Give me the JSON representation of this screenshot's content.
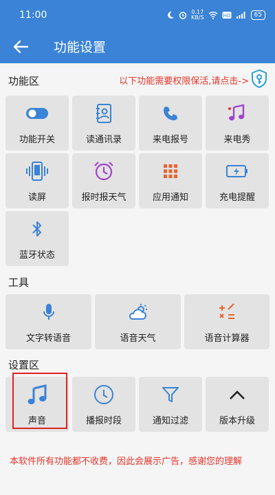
{
  "status_bar": {
    "time": "11:00",
    "net_speed": "0.17",
    "net_unit": "KB/S",
    "battery": "65"
  },
  "app_bar": {
    "title": "功能设置"
  },
  "sections": {
    "functions": "功能区",
    "notice": "以下功能需要权限保活,请点击->",
    "tools": "工具",
    "settings": "设置区"
  },
  "functions": [
    {
      "label": "功能开关",
      "icon": "toggle-icon"
    },
    {
      "label": "读通讯录",
      "icon": "contacts-icon"
    },
    {
      "label": "来电报号",
      "icon": "phone-icon"
    },
    {
      "label": "来电秀",
      "icon": "music-icon"
    },
    {
      "label": "读屏",
      "icon": "vibrate-phone-icon"
    },
    {
      "label": "报时报天气",
      "icon": "alarm-clock-icon"
    },
    {
      "label": "应用通知",
      "icon": "grid-icon"
    },
    {
      "label": "充电提醒",
      "icon": "battery-charging-icon"
    },
    {
      "label": "蓝牙状态",
      "icon": "bluetooth-icon"
    }
  ],
  "tools": [
    {
      "label": "文字转语音",
      "icon": "microphone-icon"
    },
    {
      "label": "语音天气",
      "icon": "weather-icon"
    },
    {
      "label": "语音计算器",
      "icon": "calculator-icon"
    }
  ],
  "settings": [
    {
      "label": "声音",
      "icon": "music-note-icon"
    },
    {
      "label": "播报时段",
      "icon": "clock-icon"
    },
    {
      "label": "通知过滤",
      "icon": "filter-icon"
    },
    {
      "label": "版本升级",
      "icon": "chevron-up-icon"
    }
  ],
  "footer": "本软件所有功能都不收费，因此会展示广告，感谢您的理解",
  "colors": {
    "primary": "#3a83d6",
    "purple": "#a044c8",
    "orange": "#e8622a",
    "alert": "#e5352a"
  }
}
